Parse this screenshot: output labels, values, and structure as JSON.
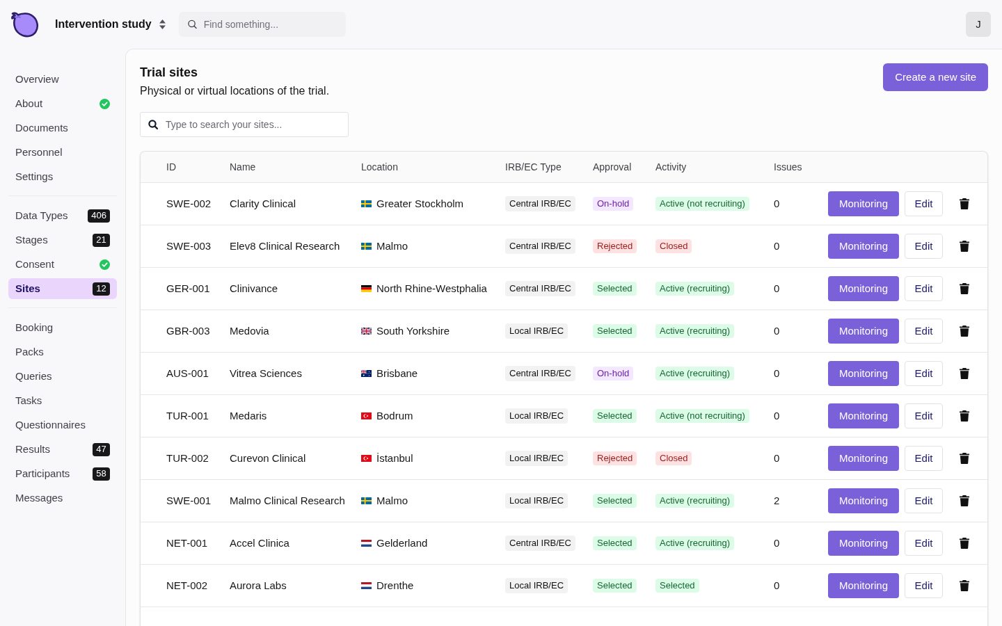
{
  "header": {
    "study": "Intervention study",
    "search": {
      "placeholder": "Find something..."
    },
    "avatar": "J"
  },
  "sidebar": {
    "groups": [
      {
        "items": [
          {
            "label": "Overview",
            "selected": false,
            "checked": false
          },
          {
            "label": "About",
            "selected": false,
            "checked": true
          },
          {
            "label": "Documents",
            "selected": false,
            "checked": false
          },
          {
            "label": "Personnel",
            "selected": false,
            "checked": false
          },
          {
            "label": "Settings",
            "selected": false,
            "checked": false
          }
        ]
      },
      {
        "items": [
          {
            "label": "Data Types",
            "selected": false,
            "checked": false,
            "count": "406"
          },
          {
            "label": "Stages",
            "selected": false,
            "checked": false,
            "count": "21"
          },
          {
            "label": "Consent",
            "selected": false,
            "checked": true
          },
          {
            "label": "Sites",
            "selected": true,
            "checked": false,
            "count": "12"
          }
        ]
      },
      {
        "items": [
          {
            "label": "Booking",
            "selected": false,
            "checked": false
          },
          {
            "label": "Packs",
            "selected": false,
            "checked": false
          },
          {
            "label": "Queries",
            "selected": false,
            "checked": false
          },
          {
            "label": "Tasks",
            "selected": false,
            "checked": false
          },
          {
            "label": "Questionnaires",
            "selected": false,
            "checked": false
          },
          {
            "label": "Results",
            "selected": false,
            "checked": false,
            "count": "47"
          },
          {
            "label": "Participants",
            "selected": false,
            "checked": false,
            "count": "58"
          },
          {
            "label": "Messages",
            "selected": false,
            "checked": false
          }
        ]
      }
    ]
  },
  "page": {
    "title": "Trial sites",
    "subtitle": "Physical or virtual locations of the trial.",
    "create_button": "Create a new site",
    "search": {
      "placeholder": "Type to search your sites..."
    }
  },
  "table": {
    "columns": [
      "ID",
      "Name",
      "Location",
      "IRB/EC Type",
      "Approval",
      "Activity",
      "Issues"
    ],
    "rows": [
      {
        "id": "SWE-002",
        "name": "Clarity Clinical",
        "location": {
          "text": "Greater Stockholm",
          "kind": "sweden"
        },
        "irb_type": "Central IRB/EC",
        "approval": {
          "text": "On-hold",
          "kind": "pending"
        },
        "activity": {
          "text": "Active (not recruiting)",
          "kind": "positive"
        },
        "issues": "0",
        "monitoring": "Monitoring",
        "edit": "Edit"
      },
      {
        "id": "SWE-003",
        "name": "Elev8 Clinical Research",
        "location": {
          "text": "Malmo",
          "kind": "sweden"
        },
        "irb_type": "Central IRB/EC",
        "approval": {
          "text": "Rejected",
          "kind": "negative"
        },
        "activity": {
          "text": "Closed",
          "kind": "negative"
        },
        "issues": "0",
        "monitoring": "Monitoring",
        "edit": "Edit"
      },
      {
        "id": "GER-001",
        "name": "Clinivance",
        "location": {
          "text": "North Rhine-Westphalia",
          "kind": "germany"
        },
        "irb_type": "Central IRB/EC",
        "approval": {
          "text": "Selected",
          "kind": "positive"
        },
        "activity": {
          "text": "Active (recruiting)",
          "kind": "positive"
        },
        "issues": "0",
        "monitoring": "Monitoring",
        "edit": "Edit"
      },
      {
        "id": "GBR-003",
        "name": "Medovia",
        "location": {
          "text": "South Yorkshire",
          "kind": "uk"
        },
        "irb_type": "Local IRB/EC",
        "approval": {
          "text": "Selected",
          "kind": "positive"
        },
        "activity": {
          "text": "Active (recruiting)",
          "kind": "positive"
        },
        "issues": "0",
        "monitoring": "Monitoring",
        "edit": "Edit"
      },
      {
        "id": "AUS-001",
        "name": "Vitrea Sciences",
        "location": {
          "text": "Brisbane",
          "kind": "australia"
        },
        "irb_type": "Central IRB/EC",
        "approval": {
          "text": "On-hold",
          "kind": "pending"
        },
        "activity": {
          "text": "Active (recruiting)",
          "kind": "positive"
        },
        "issues": "0",
        "monitoring": "Monitoring",
        "edit": "Edit"
      },
      {
        "id": "TUR-001",
        "name": "Medaris",
        "location": {
          "text": "Bodrum",
          "kind": "turkey"
        },
        "irb_type": "Local IRB/EC",
        "approval": {
          "text": "Selected",
          "kind": "positive"
        },
        "activity": {
          "text": "Active (not recruiting)",
          "kind": "positive"
        },
        "issues": "0",
        "monitoring": "Monitoring",
        "edit": "Edit"
      },
      {
        "id": "TUR-002",
        "name": "Curevon Clinical",
        "location": {
          "text": "İstanbul",
          "kind": "turkey"
        },
        "irb_type": "Local IRB/EC",
        "approval": {
          "text": "Rejected",
          "kind": "negative"
        },
        "activity": {
          "text": "Closed",
          "kind": "negative"
        },
        "issues": "0",
        "monitoring": "Monitoring",
        "edit": "Edit"
      },
      {
        "id": "SWE-001",
        "name": "Malmo Clinical Research",
        "location": {
          "text": "Malmo",
          "kind": "sweden"
        },
        "irb_type": "Local IRB/EC",
        "approval": {
          "text": "Selected",
          "kind": "positive"
        },
        "activity": {
          "text": "Active (recruiting)",
          "kind": "positive"
        },
        "issues": "2",
        "monitoring": "Monitoring",
        "edit": "Edit"
      },
      {
        "id": "NET-001",
        "name": "Accel Clinica",
        "location": {
          "text": "Gelderland",
          "kind": "netherlands"
        },
        "irb_type": "Central IRB/EC",
        "approval": {
          "text": "Selected",
          "kind": "positive"
        },
        "activity": {
          "text": "Active (recruiting)",
          "kind": "positive"
        },
        "issues": "0",
        "monitoring": "Monitoring",
        "edit": "Edit"
      },
      {
        "id": "NET-002",
        "name": "Aurora Labs",
        "location": {
          "text": "Drenthe",
          "kind": "netherlands"
        },
        "irb_type": "Local IRB/EC",
        "approval": {
          "text": "Selected",
          "kind": "positive"
        },
        "activity": {
          "text": "Selected",
          "kind": "positive"
        },
        "issues": "0",
        "monitoring": "Monitoring",
        "edit": "Edit"
      }
    ]
  }
}
